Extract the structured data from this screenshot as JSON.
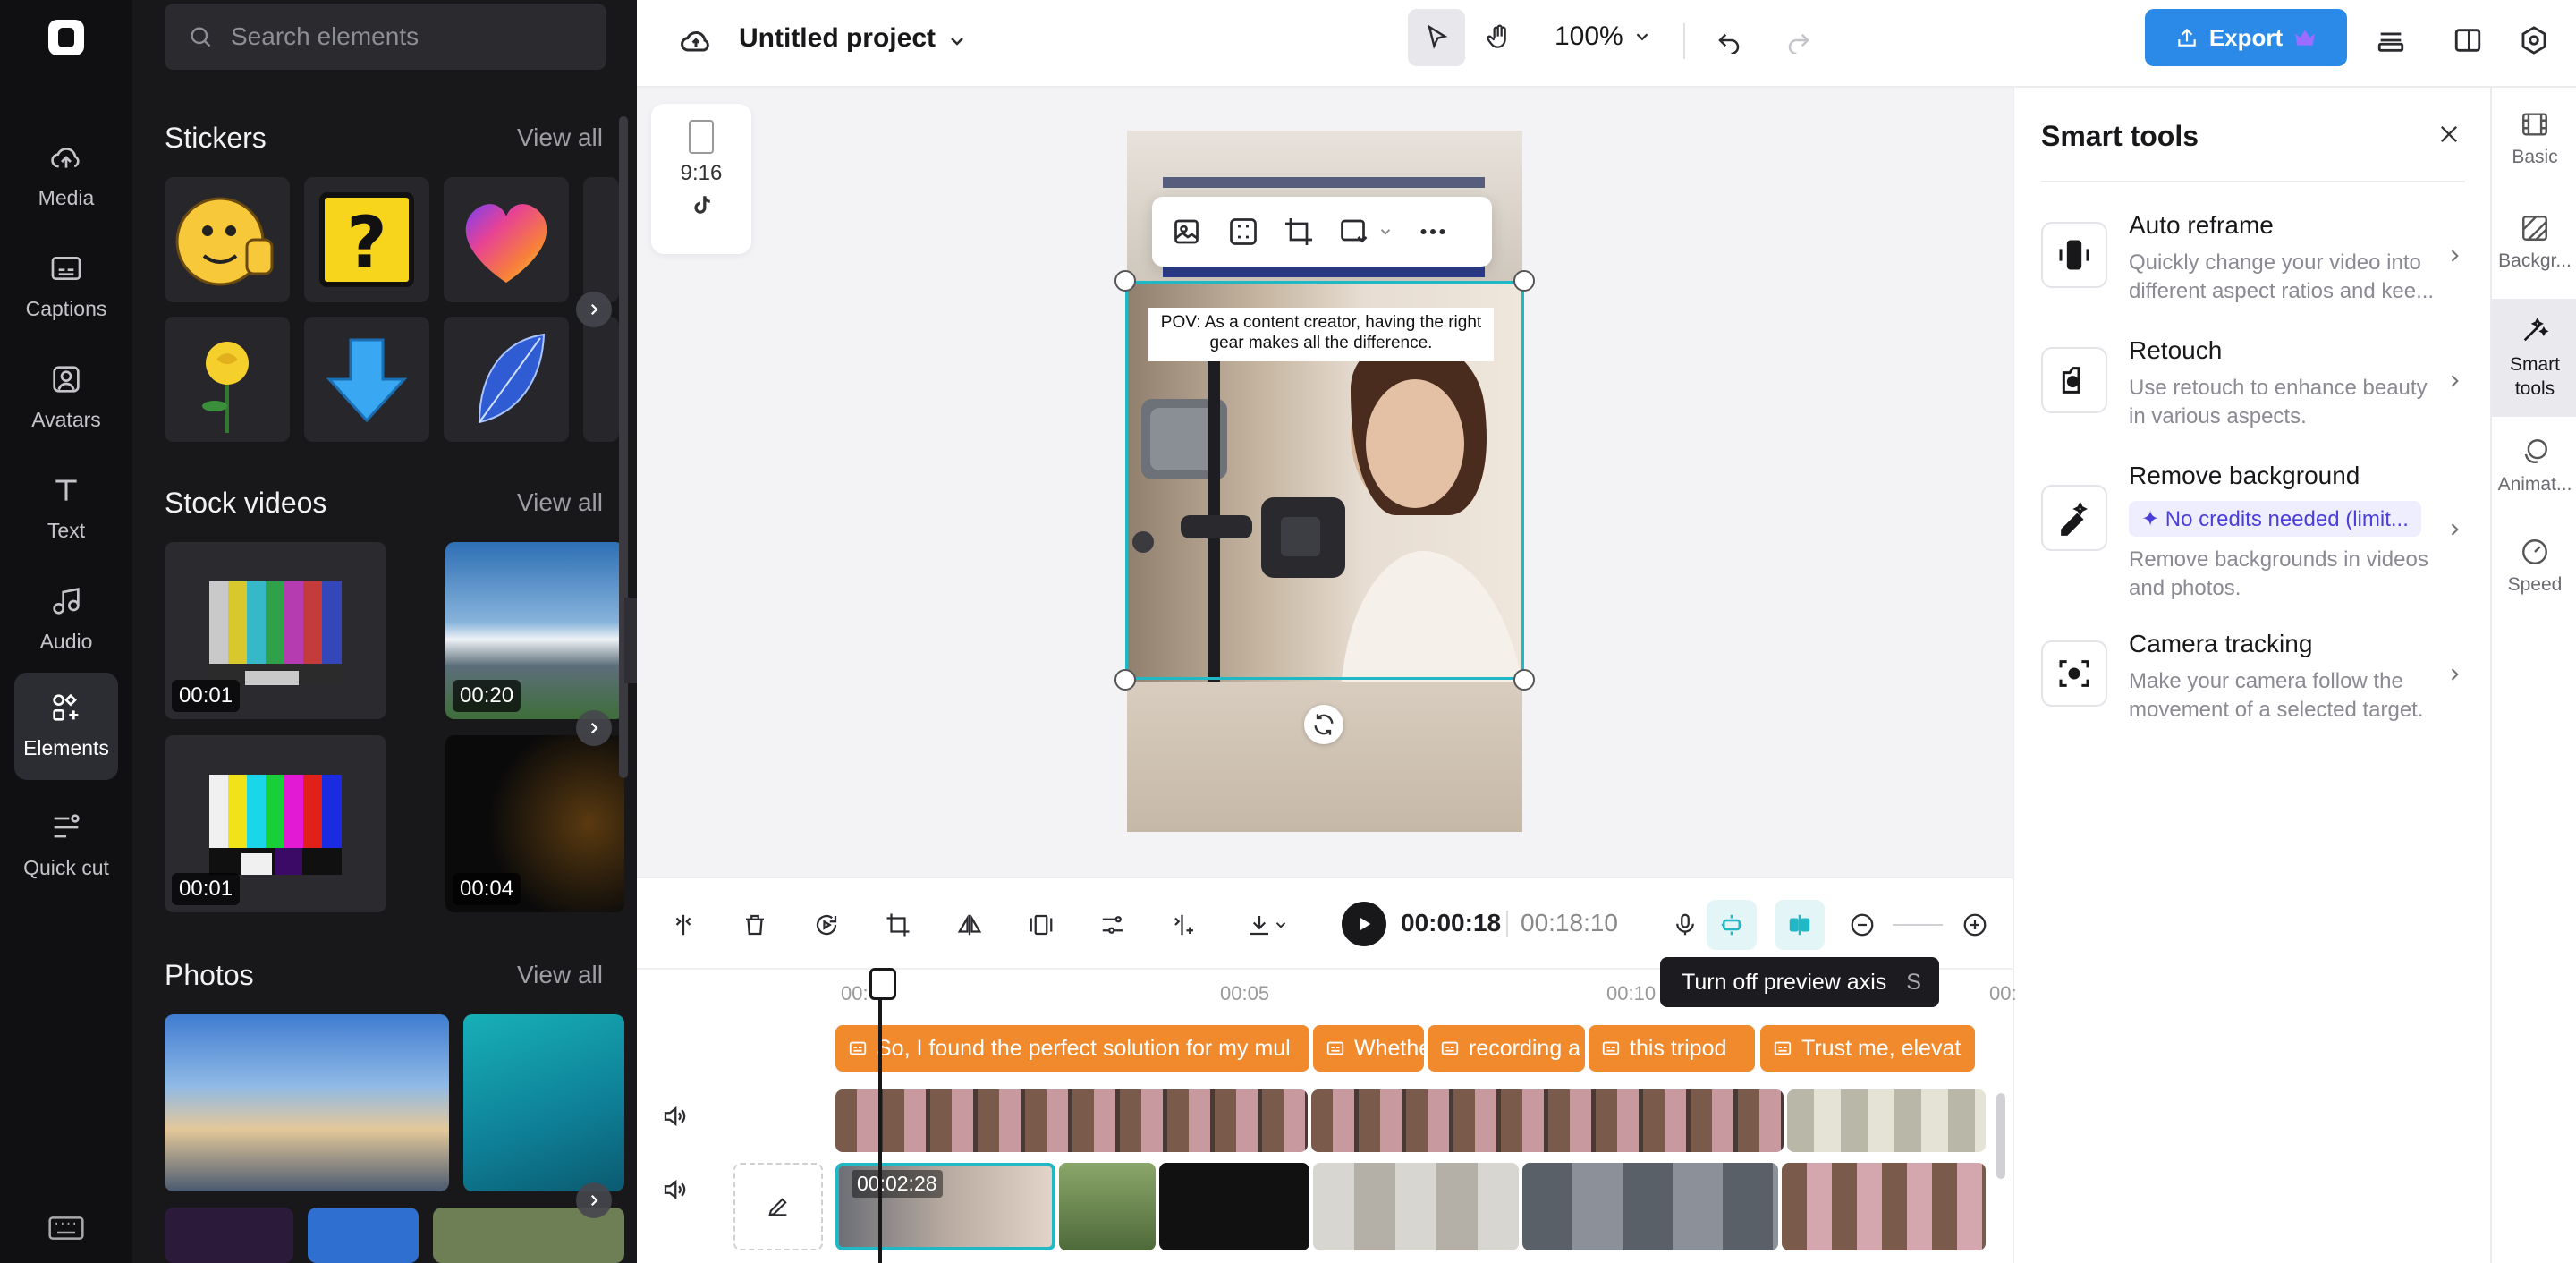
{
  "rail": {
    "items": [
      {
        "label": "Media",
        "icon": "cloud-upload-icon"
      },
      {
        "label": "Captions",
        "icon": "captions-icon"
      },
      {
        "label": "Avatars",
        "icon": "avatar-icon"
      },
      {
        "label": "Text",
        "icon": "text-icon"
      },
      {
        "label": "Audio",
        "icon": "music-note-icon"
      },
      {
        "label": "Elements",
        "icon": "elements-icon",
        "active": true
      },
      {
        "label": "Quick cut",
        "icon": "quick-cut-icon"
      }
    ]
  },
  "panel": {
    "search_placeholder": "Search elements",
    "stickers": {
      "title": "Stickers",
      "view_all": "View all"
    },
    "stock_videos": {
      "title": "Stock videos",
      "view_all": "View all",
      "durations": [
        "00:01",
        "00:20",
        "00:01",
        "00:04"
      ]
    },
    "photos": {
      "title": "Photos",
      "view_all": "View all"
    }
  },
  "topbar": {
    "project_title": "Untitled project",
    "zoom": "100%",
    "export_label": "Export"
  },
  "canvas": {
    "ratio": "9:16",
    "caption_text": "POV: As a content creator, having the right gear makes all the difference."
  },
  "smart_tools": {
    "title": "Smart tools",
    "items": [
      {
        "name": "Auto reframe",
        "desc": "Quickly change your video into different aspect ratios and kee..."
      },
      {
        "name": "Retouch",
        "desc": "Use retouch to enhance beauty in various aspects."
      },
      {
        "name": "Remove background",
        "badge": "✦ No credits needed (limit...",
        "desc": "Remove backgrounds in videos and photos."
      },
      {
        "name": "Camera tracking",
        "desc": "Make your camera follow the movement of a selected target."
      }
    ]
  },
  "right_rail": {
    "items": [
      {
        "label": "Basic"
      },
      {
        "label": "Backgr..."
      },
      {
        "label": "Smart tools",
        "active": true
      },
      {
        "label": "Animat..."
      },
      {
        "label": "Speed"
      }
    ]
  },
  "timeline": {
    "current_time": "00:00:18",
    "total_time": "00:18:10",
    "tooltip": "Turn off preview axis",
    "tooltip_key": "S",
    "ruler": [
      "00:00",
      "00:05",
      "00:10",
      "00:"
    ],
    "captions": [
      "So, I found the perfect solution for my mul",
      "Whethe",
      "recording a",
      "this tripod",
      "Trust me, elevat"
    ],
    "selected_clip_time": "00:02:28"
  }
}
